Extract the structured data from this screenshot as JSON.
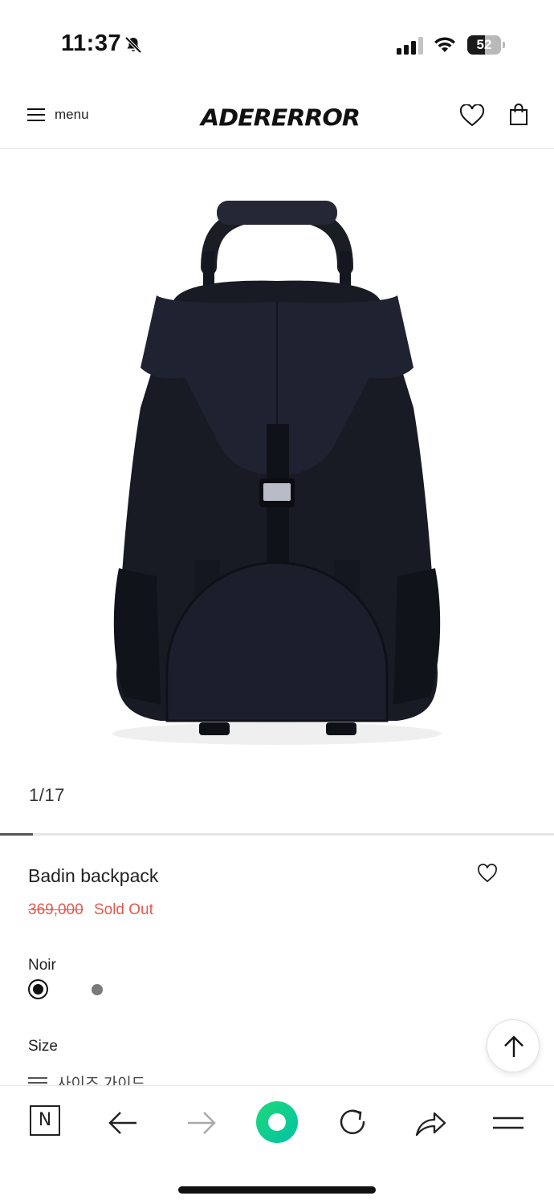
{
  "status_bar": {
    "time": "11:37",
    "battery_level": "52",
    "battery_percent": 52
  },
  "header": {
    "menu_label": "menu",
    "brand": "ADERERROR"
  },
  "gallery": {
    "counter": "1/17",
    "current": 1,
    "total": 17
  },
  "product": {
    "name": "Badin backpack",
    "original_price": "369,000",
    "status": "Sold Out",
    "color_name": "Noir",
    "size_label": "Size",
    "size_guide": "사이즈 가이드"
  },
  "colors": {
    "accent": "#e05a4f",
    "selected_swatch": "#111111",
    "other_swatch": "#7a7a7a",
    "browser_button": "#1fd87a"
  },
  "icons": {
    "header": [
      "hamburger-icon",
      "heart-icon",
      "shopping-bag-icon"
    ],
    "browser_toolbar": [
      "naver-n-icon",
      "back-arrow-icon",
      "forward-arrow-icon",
      "green-circle-icon",
      "reload-icon",
      "share-icon",
      "menu-icon"
    ]
  }
}
